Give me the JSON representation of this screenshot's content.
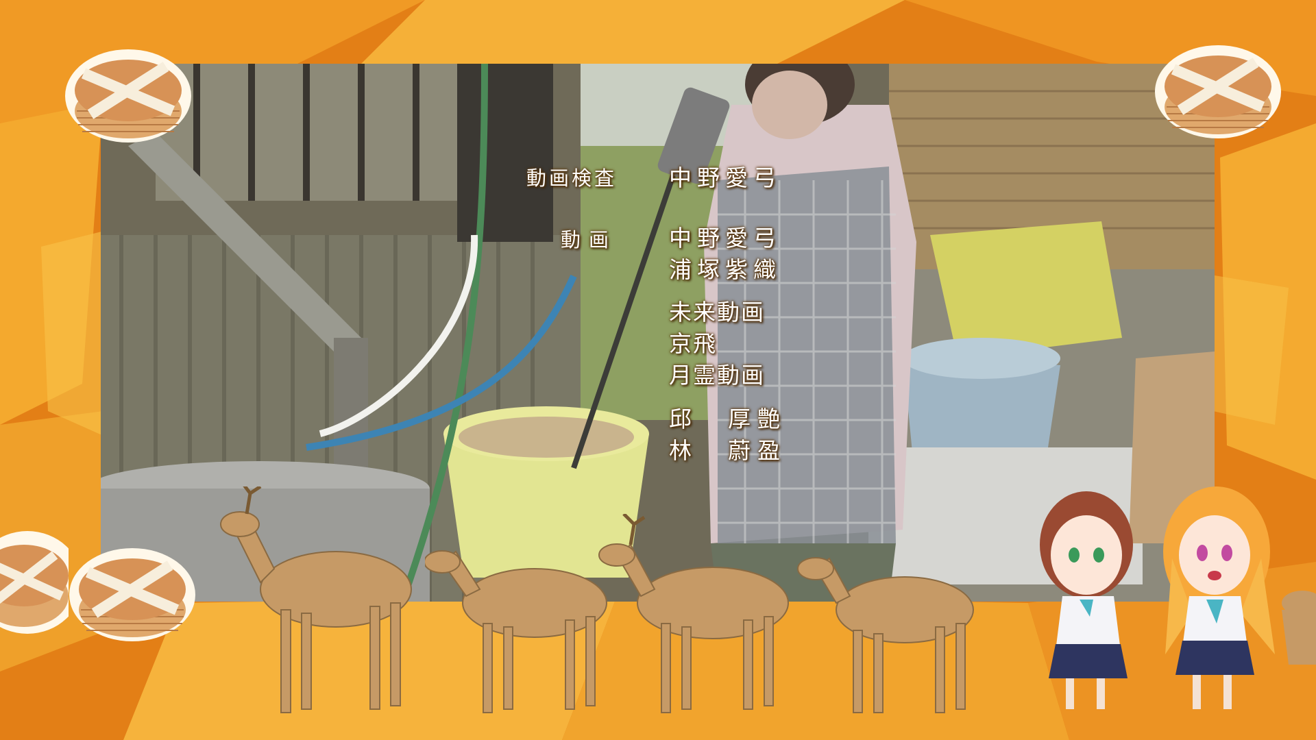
{
  "credits": {
    "block1": {
      "role": "動画検査",
      "names": [
        "中野愛弓"
      ]
    },
    "block2": {
      "role": "動画",
      "names": [
        "中野愛弓",
        "浦塚紫織"
      ]
    },
    "studios": [
      "未来動画",
      "京飛",
      "月霊動画"
    ],
    "block3": {
      "names": [
        "邱　厚艶",
        "林　蔚盈"
      ]
    }
  },
  "colors": {
    "background": "#e8891c",
    "frame_orange": "#f2a22a",
    "credit_text": "#ffffff"
  },
  "decorations": {
    "corner_icons": [
      "layered-cake-icon",
      "layered-cake-icon",
      "layered-cake-icon",
      "layered-cake-icon",
      "layered-cake-icon"
    ],
    "bottom_row": [
      "deer-icon",
      "deer-icon",
      "deer-icon",
      "deer-icon"
    ],
    "characters": [
      "chibi-girl-brown-hair",
      "chibi-girl-blonde-hair"
    ]
  }
}
